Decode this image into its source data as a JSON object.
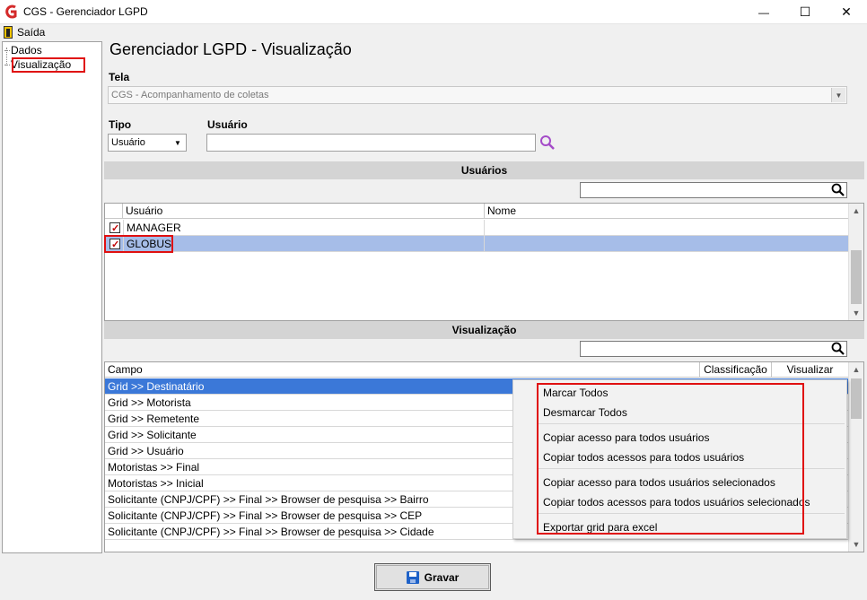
{
  "window": {
    "title": "CGS - Gerenciador LGPD",
    "minimize": "—",
    "maximize": "☐",
    "close": "✕"
  },
  "menu": {
    "exit_label": "Saída"
  },
  "tree": {
    "items": [
      "Dados",
      "Visualização"
    ]
  },
  "page_title": "Gerenciador LGPD - Visualização",
  "tela": {
    "label": "Tela",
    "value": "CGS - Acompanhamento de coletas"
  },
  "tipo": {
    "label": "Tipo",
    "value": "Usuário"
  },
  "usuario_filter": {
    "label": "Usuário",
    "value": ""
  },
  "users_section": {
    "header": "Usuários",
    "search_value": "",
    "columns": [
      "Usuário",
      "Nome"
    ],
    "rows": [
      {
        "user": "MANAGER",
        "name": "",
        "checked": true,
        "selected": false
      },
      {
        "user": "GLOBUS",
        "name": "",
        "checked": true,
        "selected": true
      }
    ]
  },
  "vis_section": {
    "header": "Visualização",
    "search_value": "",
    "columns": [
      "Campo",
      "Classificação",
      "Visualizar"
    ],
    "rows": [
      "Grid >> Destinatário",
      "Grid >> Motorista",
      "Grid >> Remetente",
      "Grid >> Solicitante",
      "Grid >> Usuário",
      "Motoristas >> Final",
      "Motoristas >> Inicial",
      "Solicitante (CNPJ/CPF) >> Final >> Browser de pesquisa >> Bairro",
      "Solicitante (CNPJ/CPF) >> Final >> Browser de pesquisa >> CEP",
      "Solicitante (CNPJ/CPF) >> Final >> Browser de pesquisa >> Cidade"
    ]
  },
  "context_menu": {
    "items": [
      "Marcar Todos",
      "Desmarcar Todos",
      "Copiar acesso para todos usuários",
      "Copiar todos acessos para todos usuários",
      "Copiar acesso para todos usuários selecionados",
      "Copiar todos acessos para todos usuários selecionados",
      "Exportar grid para excel"
    ]
  },
  "save_button": {
    "label": "Gravar"
  },
  "colors": {
    "selection": "#a6bde8",
    "highlight_row": "#3b78d8",
    "annotation": "#e01010",
    "logo": "#d42a2a"
  }
}
